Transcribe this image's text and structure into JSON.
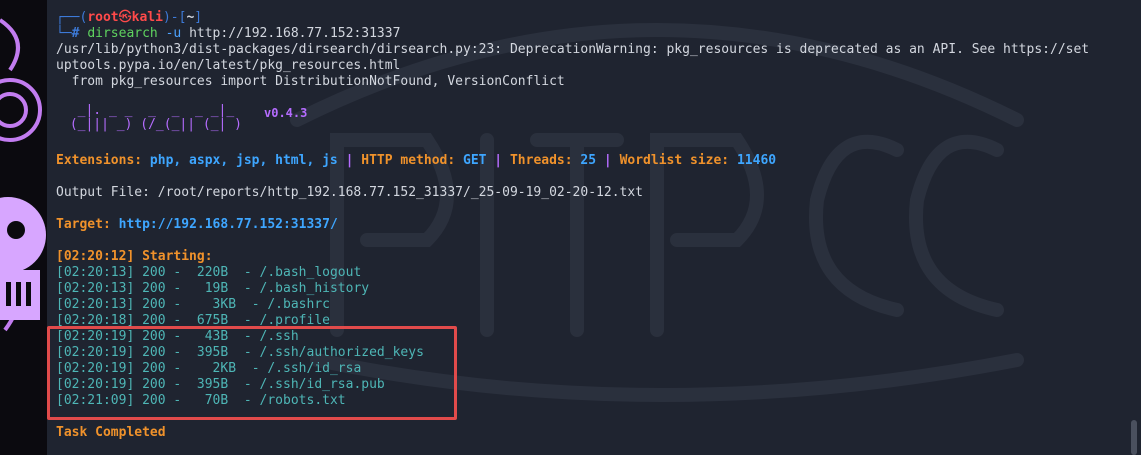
{
  "prompt": {
    "frame_top": "┌──(",
    "user": "root",
    "skull": "㉿",
    "host": "kali",
    "frame_mid": ")-[",
    "path": "~",
    "frame_end": "]",
    "frame_bottom": "└─",
    "hash": "#",
    "command": "dirsearch",
    "flag": "-u",
    "url": "http://192.168.77.152:31337"
  },
  "warning": {
    "line1": "/usr/lib/python3/dist-packages/dirsearch/dirsearch.py:23: DeprecationWarning: pkg_resources is deprecated as an API. See https://set",
    "line2": "uptools.pypa.io/en/latest/pkg_resources.html",
    "line3": "  from pkg_resources import DistributionNotFound, VersionConflict"
  },
  "banner": {
    "art": "  _|. _ _  _  _  _ _|_\n (_||| _) (/_(_|| (_| )",
    "version": "v0.4.3"
  },
  "config": {
    "ext_label": "Extensions: ",
    "ext_value": "php, aspx, jsp, html, js",
    "sep1": " | ",
    "method_label": "HTTP method: ",
    "method_value": "GET",
    "sep2": " | ",
    "threads_label": "Threads: ",
    "threads_value": "25",
    "sep3": " | ",
    "wordlist_label": "Wordlist size: ",
    "wordlist_value": "11460"
  },
  "output_file": "Output File: /root/reports/http_192.168.77.152_31337/_25-09-19_02-20-12.txt",
  "target": {
    "label": "Target: ",
    "value": "http://192.168.77.152:31337/"
  },
  "starting": "[02:20:12] Starting:",
  "results": [
    {
      "time": "[02:20:13]",
      "status": "200",
      "size": " 220B",
      "path": "/.bash_logout"
    },
    {
      "time": "[02:20:13]",
      "status": "200",
      "size": "  19B",
      "path": "/.bash_history"
    },
    {
      "time": "[02:20:13]",
      "status": "200",
      "size": "   3KB",
      "path": "/.bashrc"
    },
    {
      "time": "[02:20:18]",
      "status": "200",
      "size": " 675B",
      "path": "/.profile"
    },
    {
      "time": "[02:20:19]",
      "status": "200",
      "size": "  43B",
      "path": "/.ssh"
    },
    {
      "time": "[02:20:19]",
      "status": "200",
      "size": " 395B",
      "path": "/.ssh/authorized_keys"
    },
    {
      "time": "[02:20:19]",
      "status": "200",
      "size": "   2KB",
      "path": "/.ssh/id_rsa"
    },
    {
      "time": "[02:20:19]",
      "status": "200",
      "size": " 395B",
      "path": "/.ssh/id_rsa.pub"
    },
    {
      "time": "[02:21:09]",
      "status": "200",
      "size": "  70B",
      "path": "/robots.txt"
    }
  ],
  "task_completed": "Task Completed",
  "colors": {
    "background": "#1f2430",
    "accent_orange": "#f0922b",
    "accent_blue": "#3ea6ff",
    "accent_purple": "#b56cff",
    "highlight": "#e14b4b",
    "result_text": "#4eb6b6"
  }
}
